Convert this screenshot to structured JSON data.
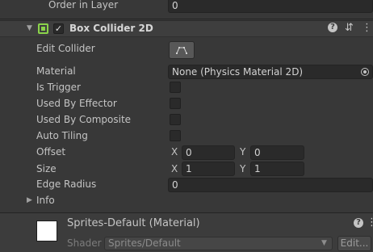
{
  "order_in_layer": {
    "label": "Order in Layer",
    "value": "0"
  },
  "component": {
    "title": "Box Collider 2D",
    "accent": "#8ad34a",
    "icons": [
      "help-icon",
      "preset-icon",
      "kebab-menu-icon"
    ]
  },
  "edit_collider": {
    "label": "Edit Collider",
    "icon": "edit-collider-icon"
  },
  "material": {
    "label": "Material",
    "value": "None (Physics Material 2D)"
  },
  "is_trigger": {
    "label": "Is Trigger"
  },
  "used_by_effector": {
    "label": "Used By Effector"
  },
  "used_by_composite": {
    "label": "Used By Composite"
  },
  "auto_tiling": {
    "label": "Auto Tiling"
  },
  "offset": {
    "label": "Offset",
    "x_axis": "X",
    "x": "0",
    "y_axis": "Y",
    "y": "0"
  },
  "size": {
    "label": "Size",
    "x_axis": "X",
    "x": "1",
    "y_axis": "Y",
    "y": "1"
  },
  "edge_radius": {
    "label": "Edge Radius",
    "value": "0"
  },
  "info": {
    "label": "Info"
  },
  "material_asset": {
    "title": "Sprites-Default (Material)",
    "shader_label": "Shader",
    "shader_value": "Sprites/Default",
    "edit_label": "Edit..."
  }
}
